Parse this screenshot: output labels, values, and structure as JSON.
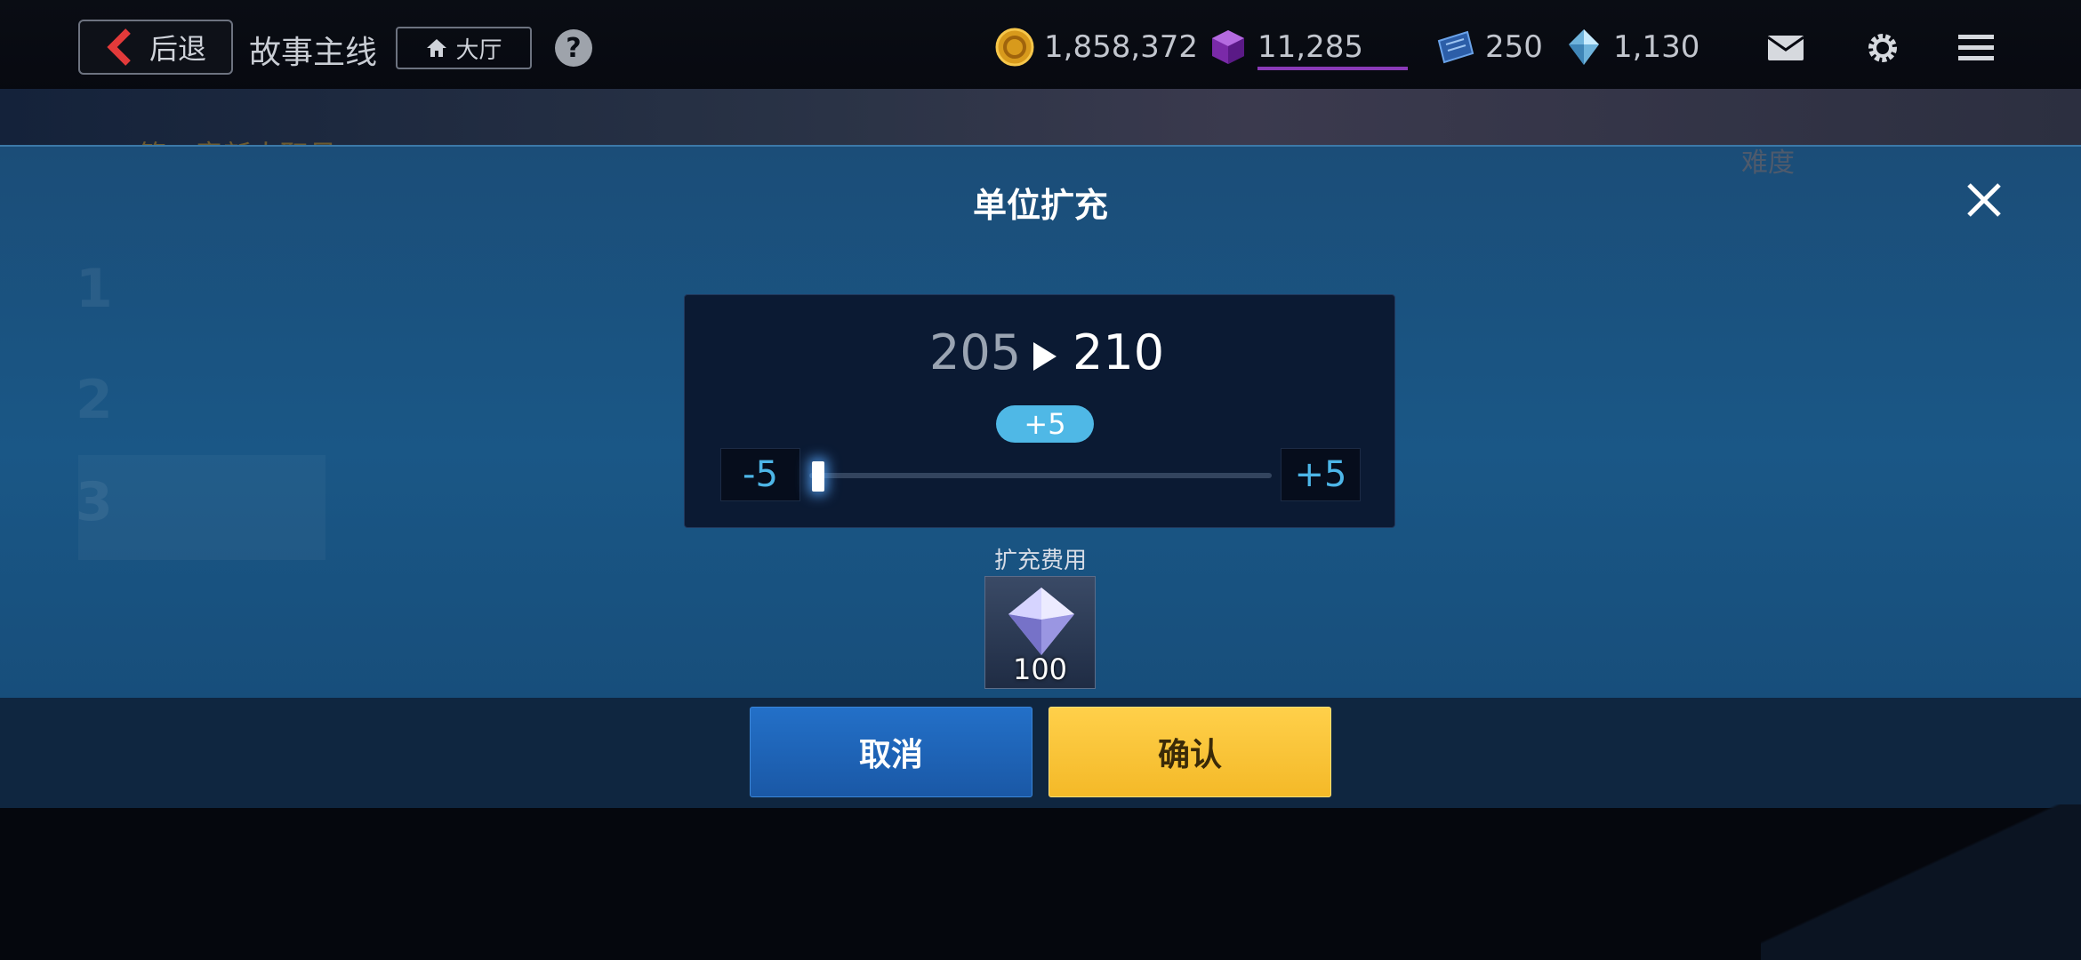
{
  "topbar": {
    "back_label": "后退",
    "page_title": "故事主线",
    "lobby_label": "大厅",
    "help_symbol": "?",
    "currencies": [
      {
        "name": "gold-coin-icon",
        "value": "1,858,372",
        "color": "#d89a1c"
      },
      {
        "name": "purple-cube-icon",
        "value": "11,285",
        "color": "#8a3ab8"
      },
      {
        "name": "blue-ticket-icon",
        "value": "250",
        "color": "#3c7fd0"
      },
      {
        "name": "crystal-icon",
        "value": "1,130",
        "color": "#9ccfe8"
      }
    ]
  },
  "background": {
    "chapter_text": "第一章新人职员",
    "difficulty_text": "难度",
    "list_numbers": [
      "1",
      "2",
      "3"
    ]
  },
  "modal": {
    "title": "单位扩充",
    "from_value": "205",
    "to_value": "210",
    "delta_badge": "+5",
    "decrement_label": "-5",
    "increment_label": "+5",
    "slider_fraction": 0,
    "cost_label": "扩充费用",
    "cost_item_icon": "diamond-icon",
    "cost_amount": "100"
  },
  "buttons": {
    "cancel_label": "取消",
    "confirm_label": "确认"
  },
  "colors": {
    "accent_blue": "#4fb8e6",
    "confirm_yellow": "#f4b928",
    "cancel_blue": "#1a58a6",
    "modal_bg": "#1a5786"
  }
}
